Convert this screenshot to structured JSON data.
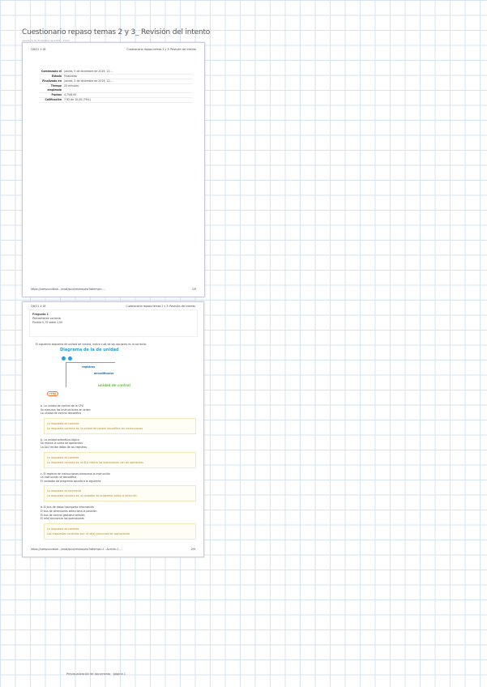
{
  "doc": {
    "title": "Cuestionario repaso temas 2 y 3_ Revisión del intento",
    "subtitle": "jueves, 5 de diciembre de 2019 · 12:01"
  },
  "page1": {
    "header_left": "2/6/21 1:18",
    "header_center": "Cuestionario repaso temas 2 y 3: Revisión del intento",
    "summary": [
      {
        "k": "Comenzado el",
        "v": "jueves, 5 de diciembre de 2019, 11:..."
      },
      {
        "k": "Estado",
        "v": "Finalizado"
      },
      {
        "k": "Finalizado en",
        "v": "jueves, 5 de diciembre de 2019, 12:..."
      },
      {
        "k": "Tiempo empleado",
        "v": "22 minutos"
      },
      {
        "k": "Puntos",
        "v": "4,75/6,00"
      },
      {
        "k": "Calificación",
        "v": "7,92 de 10,00 (79%)"
      }
    ],
    "footer_url": "https://campusvirtual.../mod/quiz/review.php?attempt=...",
    "footer_page": "1/9"
  },
  "page2": {
    "header_left": "2/6/21 1:18",
    "header_center": "Cuestionario repaso temas 2 y 3: Revisión del intento",
    "info": [
      "Pregunta 1",
      "Parcialmente correcta",
      "Puntúa 0,75 sobre 1,00"
    ],
    "question": "El siguiente esquema de unidad de control, indica cuál de las opciones es la correcta:",
    "diagram": {
      "title": "Diagrama de la de unidad",
      "label1": "registros",
      "label2": "decodificador",
      "label3": "unidad de control",
      "label4": "reloj"
    },
    "options": [
      {
        "lines": [
          "a. La unidad de control de la CPU",
          "Se ejecutan las instrucciones en orden",
          "La unidad de control decodifica"
        ],
        "fb1": "La respuesta es correcta",
        "fb2": "La respuesta correcta es: la unidad de control decodifica las instrucciones"
      },
      {
        "lines": [
          "b. La unidad aritmético-lógica",
          "Se realiza la suma de operandos",
          "La ALU recibe datos de los registros"
        ],
        "fb1": "La respuesta es correcta",
        "fb2": "La respuesta correcta es: la ALU realiza las operaciones con los operandos"
      },
      {
        "lines": [
          "c. El registro de instrucciones almacena la instrucción",
          "La instrucción se decodifica",
          "El contador de programa apunta a la siguiente"
        ],
        "fb1": "La respuesta es incorrecta",
        "fb2": "La respuesta correcta es: el contador de programa indica la dirección"
      },
      {
        "lines": [
          "d. El bus de datos transporta información",
          "El bus de direcciones selecciona la posición",
          "El bus de control gestiona señales",
          "El reloj sincroniza las operaciones"
        ],
        "fb1": "La respuesta es correcta",
        "fb2": "Las respuestas correctas son: el reloj sincroniza las operaciones"
      }
    ],
    "footer_url": "https://campusvirtual.../mod/quiz/review.php?attempt=1...&cmid=1...",
    "footer_page": "2/9"
  },
  "caption": "Previsualización de documento · página 1"
}
